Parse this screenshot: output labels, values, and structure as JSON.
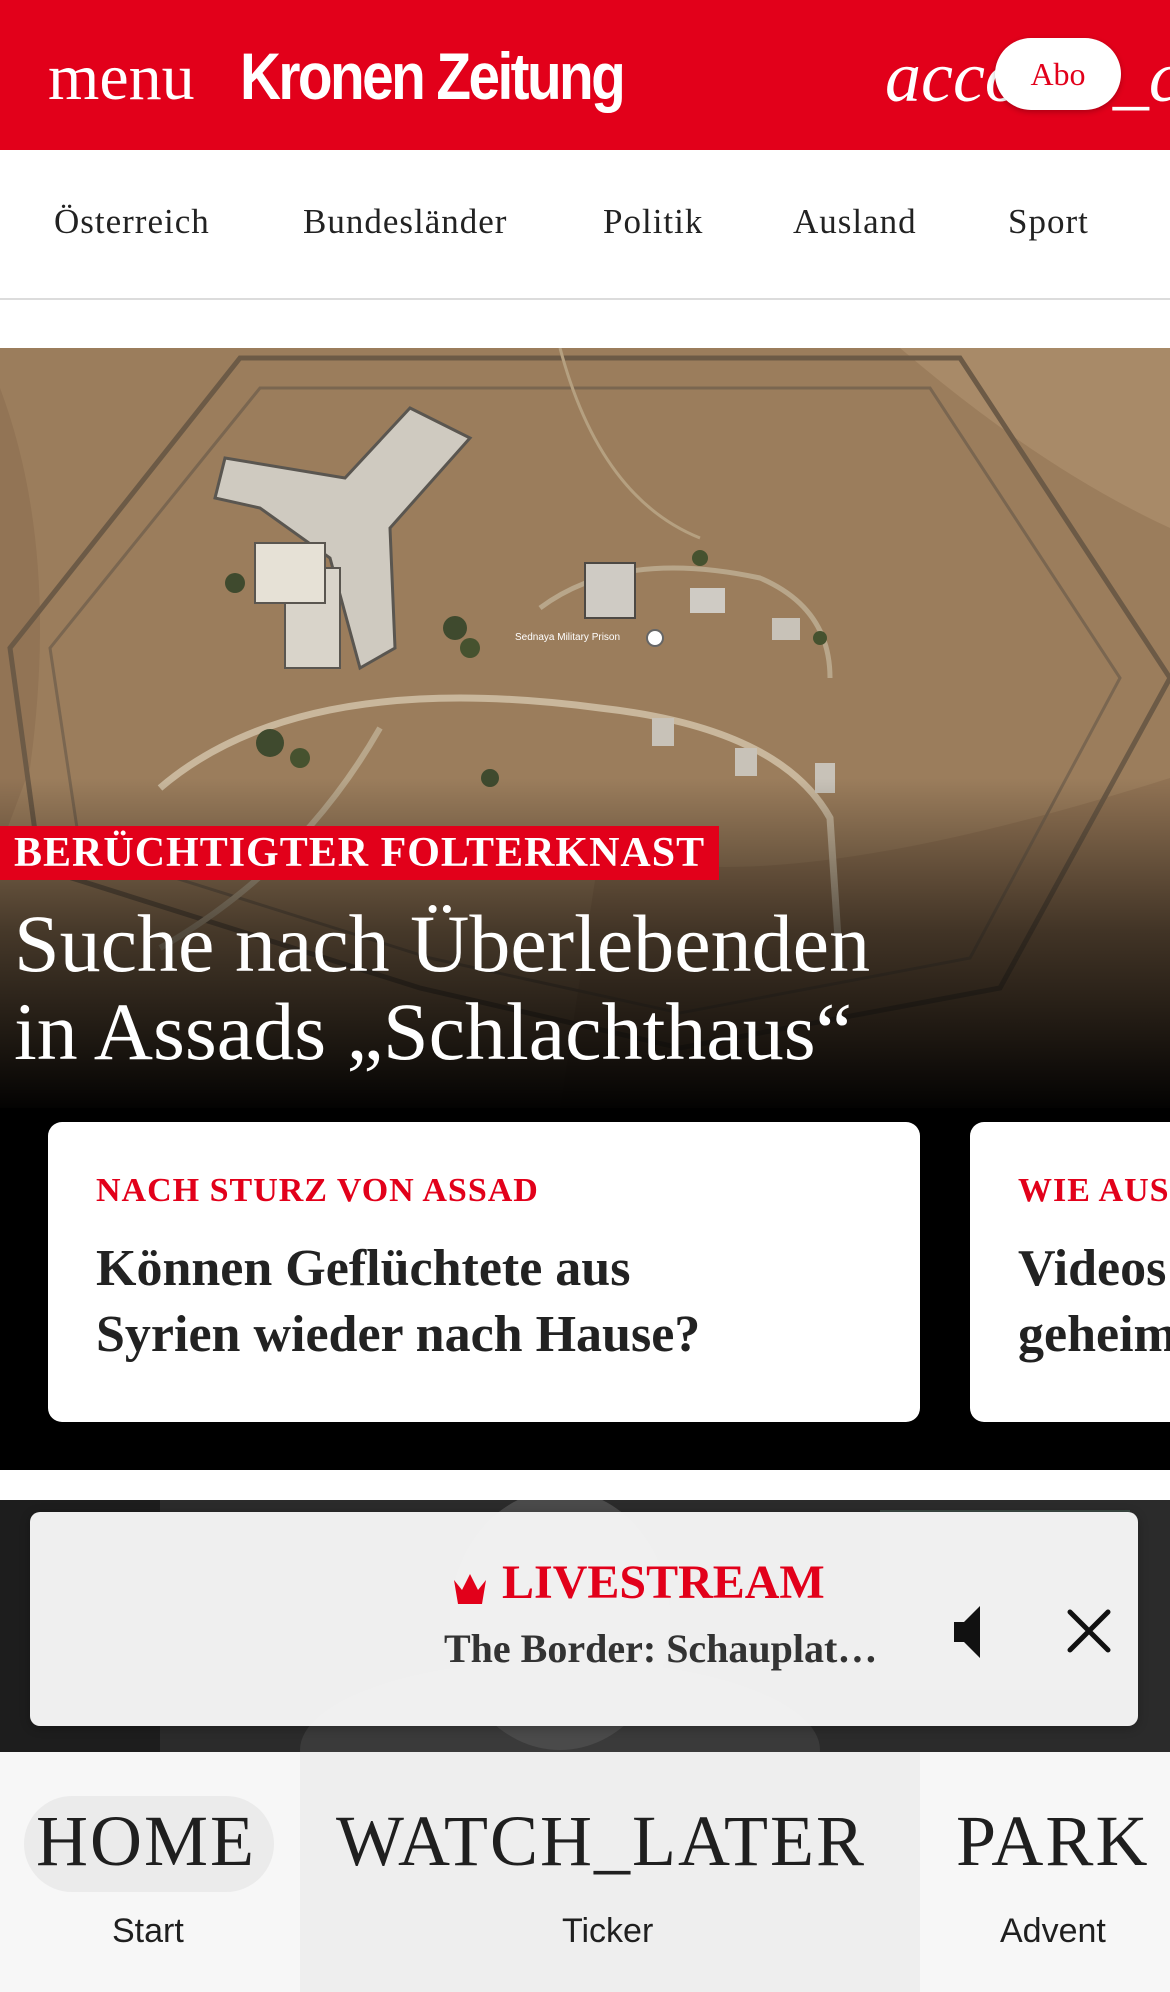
{
  "header": {
    "menu_label": "menu",
    "logo": "Kronen Zeitung",
    "account_label": "account_circle",
    "abo_label": "Abo",
    "brand_color": "#e2001a"
  },
  "nav": {
    "items": [
      "Österreich",
      "Bundesländer",
      "Politik",
      "Ausland",
      "Sport"
    ]
  },
  "hero": {
    "image_caption": "Sednaya Military Prison",
    "kicker": "BERÜCHTIGTER FOLTERKNAST",
    "headline_line1": "Suche nach Überlebenden",
    "headline_line2": "in Assads „Schlachthaus“",
    "cards": [
      {
        "kicker": "NACH STURZ VON ASSAD",
        "title_line1": "Können Geflüchtete aus",
        "title_line2": "Syrien wieder nach Hause?"
      },
      {
        "kicker": "WIE AUS",
        "title_line1": "Videos",
        "title_line2": "geheim"
      }
    ]
  },
  "livestream": {
    "icon": "crown-icon",
    "label": "LIVESTREAM",
    "title": "The Border: Schauplat…",
    "volume_icon": "volume-icon",
    "close_icon": "close-icon"
  },
  "bottom_nav": {
    "tabs": [
      {
        "icon_name": "HOME",
        "label": "Start"
      },
      {
        "icon_name": "WATCH_LATER",
        "label": "Ticker"
      },
      {
        "icon_name": "PARK",
        "label": "Advent"
      }
    ]
  }
}
